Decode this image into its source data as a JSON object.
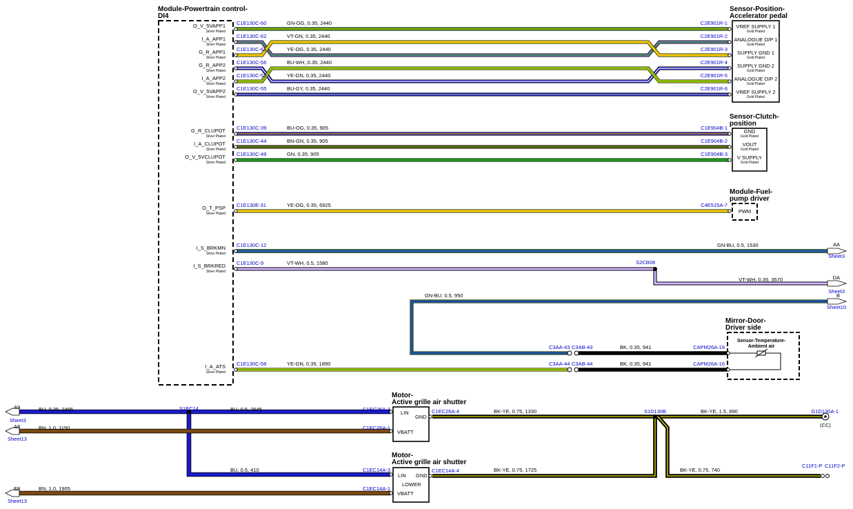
{
  "titles": {
    "pcm": [
      "Module-Powertrain control-",
      "DI4"
    ],
    "app": [
      "Sensor-Position-",
      "Accelerator pedal"
    ],
    "clutch": [
      "Sensor-Clutch-",
      "position"
    ],
    "fuel": [
      "Module-Fuel-",
      "pump driver"
    ],
    "mirror": [
      "Mirror-Door-",
      "Driver side"
    ],
    "motor1": [
      "Motor-",
      "Active grille air shutter"
    ],
    "motor2": [
      "Motor-",
      "Active grille air shutter"
    ],
    "amb": [
      "Sensor-Temperature-",
      "Ambient air"
    ]
  },
  "plating": {
    "silver": "Silver Plated",
    "gold": "Gold Plated"
  },
  "pcm_wires": [
    {
      "pin": "O_V_5VAPP1",
      "conn": "C1E130C-60",
      "spec": "GN-OG,  0.35,  2440",
      "dest": "C2E901R-1",
      "fn": "VREF SUPPLY 1"
    },
    {
      "pin": "I_A_APP1",
      "conn": "C1E130C-62",
      "spec": "VT-GN,  0.35,  2440",
      "dest": "C2E901R-2",
      "fn": "ANALOGUE O/P 1"
    },
    {
      "pin": "G_R_APP1",
      "conn": "C1E130C-61",
      "spec": "YE-OG,  0.35,  2440",
      "dest": "C2E901R-3",
      "fn": "SUPPLY GND 1"
    },
    {
      "pin": "G_R_APP2",
      "conn": "C1E130C-56",
      "spec": "BU-WH,  0.35,  2440",
      "dest": "C2E901R-4",
      "fn": "SUPPLY GND 2"
    },
    {
      "pin": "I_A_APP2",
      "conn": "C1E130C-57",
      "spec": "YE-GN,  0.35,  2440",
      "dest": "C2E901R-5",
      "fn": "ANALOGUE O/P 2"
    },
    {
      "pin": "O_V_5VAPP2",
      "conn": "C1E130C-55",
      "spec": "BU-GY,  0.35,  2440",
      "dest": "C2E901R-6",
      "fn": "VREF SUPPLY 2"
    },
    {
      "pin": "G_R_CLUPOT",
      "conn": "C1E130C-39",
      "spec": "BU-OG,  0.35,  905",
      "dest": "C1E904B-1",
      "fn": "GND"
    },
    {
      "pin": "I_A_CLUPOT",
      "conn": "C1E130C-44",
      "spec": "BN-GN,  0.35,  905",
      "dest": "C1E904B-2",
      "fn": "VOUT"
    },
    {
      "pin": "O_V_5VCLUPOT",
      "conn": "C1E130C-49",
      "spec": "GN,  0.35,  905",
      "dest": "C1E904B-3",
      "fn": "V SUPPLY"
    },
    {
      "pin": "O_T_PSP",
      "conn": "C1E130E-31",
      "spec": "YE-OG,  0.35,  6925",
      "dest": "C4E515A-7",
      "fn": "PWM"
    },
    {
      "pin": "I_S_BRKMN",
      "conn": "C1E130C-12",
      "spec": "GN-BU,  0.5,  1530",
      "dest": "AA",
      "fn": "Sheet3"
    },
    {
      "pin": "I_S_BRKRED",
      "conn": "C1E130C-9",
      "spec": "VT-WH,  0.5,  1580",
      "dest": "S2CB08",
      "fn": ""
    },
    {
      "pin": "I_A_ATS",
      "conn": "C1E130C-58",
      "spec": "YE-GN,  0.35,  1890",
      "dest": "C3AA-44",
      "fn": ""
    }
  ],
  "brake_branch": {
    "spec": "VT-WH,  0.35,  3570",
    "dest": "DA",
    "sheet": "Sheet3"
  },
  "gnbu_line": {
    "spec": "GN-BU,  0.5,  950",
    "dest": "B",
    "sheet": "Sheet10"
  },
  "mirror_wires": [
    {
      "c1": "C3AA-43",
      "c2": "C3AB-43",
      "spec": "BK,  0.35,  941",
      "dest": "CAPM26A-18"
    },
    {
      "c1": "C3AA-44",
      "c2": "C3AB-44",
      "spec": "BK,  0.35,  941",
      "dest": "CAPM26A-16"
    }
  ],
  "lower": {
    "a9": {
      "id": "A9",
      "sheet": "Sheet3",
      "spec": "BU,  0.35,  2465"
    },
    "a8": {
      "id": "A8",
      "sheet": "Sheet13",
      "spec": "BN,  1.0,  1150"
    },
    "e8": {
      "id": "E8",
      "sheet": "Sheet13",
      "spec": "BN,  1.0,  1905"
    },
    "splice1": "S1EC14",
    "bu1": {
      "spec": "BU,  0.5,  2645",
      "dest": "C1EC26A-3"
    },
    "bn1dest": "C1EC26A-1",
    "bu2": {
      "spec": "BU,  0.5,  410",
      "dest": "C1EC14A-3"
    },
    "bn2dest": "C1EC14A-1",
    "m1": {
      "lin": "LIN",
      "gnd": "GND",
      "vbatt": "VBATT",
      "gndconn": "C1EC26A-4"
    },
    "m2": {
      "lin": "LIN",
      "gnd": "GND",
      "vbatt": "VBATT",
      "lower": "LOWER",
      "gndconn": "C1EC14A-4"
    },
    "bk1": {
      "spec": "BK-YE,  0.75,  1330"
    },
    "bk2": {
      "spec": "BK-YE,  0.75,  1725"
    },
    "splice2": "S1D130B",
    "bk3": {
      "spec": "BK-YE,  1.5,  890",
      "dest": "G1D130A-1",
      "note": "(CC)"
    },
    "bk4": {
      "spec": "BK-YE,  0.75,  740",
      "dest1": "C11F1-P",
      "dest2": "C11F2-P"
    }
  },
  "colors": {
    "GN": "#1aa31a",
    "OG": "#f5a800",
    "VT": "#8a63d2",
    "YE": "#f2e800",
    "BU": "#1b1bc8",
    "WH": "#ffffff",
    "GY": "#9aa0a6",
    "BN": "#7a4a12",
    "BK": "#000000",
    "TEAL": "#2b8c7a"
  }
}
